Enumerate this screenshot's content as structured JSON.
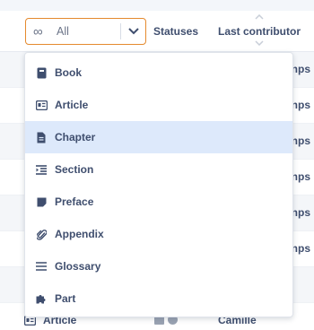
{
  "filter": {
    "icon": "infinity-icon",
    "value": "All",
    "caret_icon": "chevron-down-icon"
  },
  "columns": {
    "statuses": "Statuses",
    "last_contributor": "Last contributor"
  },
  "rows": [
    {
      "trail": "nps"
    },
    {
      "trail": "nps"
    },
    {
      "trail": "nps"
    },
    {
      "trail": "nps"
    },
    {
      "trail": "nps"
    },
    {
      "trail": "nps"
    },
    {
      "trail": ""
    }
  ],
  "last_row": {
    "type_icon": "article-icon",
    "type": "Article",
    "contributor": "Camille"
  },
  "menu": {
    "selected": "Chapter",
    "options": [
      {
        "label": "Book",
        "icon": "book-icon"
      },
      {
        "label": "Article",
        "icon": "article-icon"
      },
      {
        "label": "Chapter",
        "icon": "chapter-icon"
      },
      {
        "label": "Section",
        "icon": "section-icon"
      },
      {
        "label": "Preface",
        "icon": "preface-icon"
      },
      {
        "label": "Appendix",
        "icon": "paperclip-icon"
      },
      {
        "label": "Glossary",
        "icon": "glossary-icon"
      },
      {
        "label": "Part",
        "icon": "puzzle-icon"
      }
    ]
  },
  "colors": {
    "accent": "#e58a2e",
    "text": "#3f4e6e",
    "selected_bg": "#dde9fb"
  }
}
